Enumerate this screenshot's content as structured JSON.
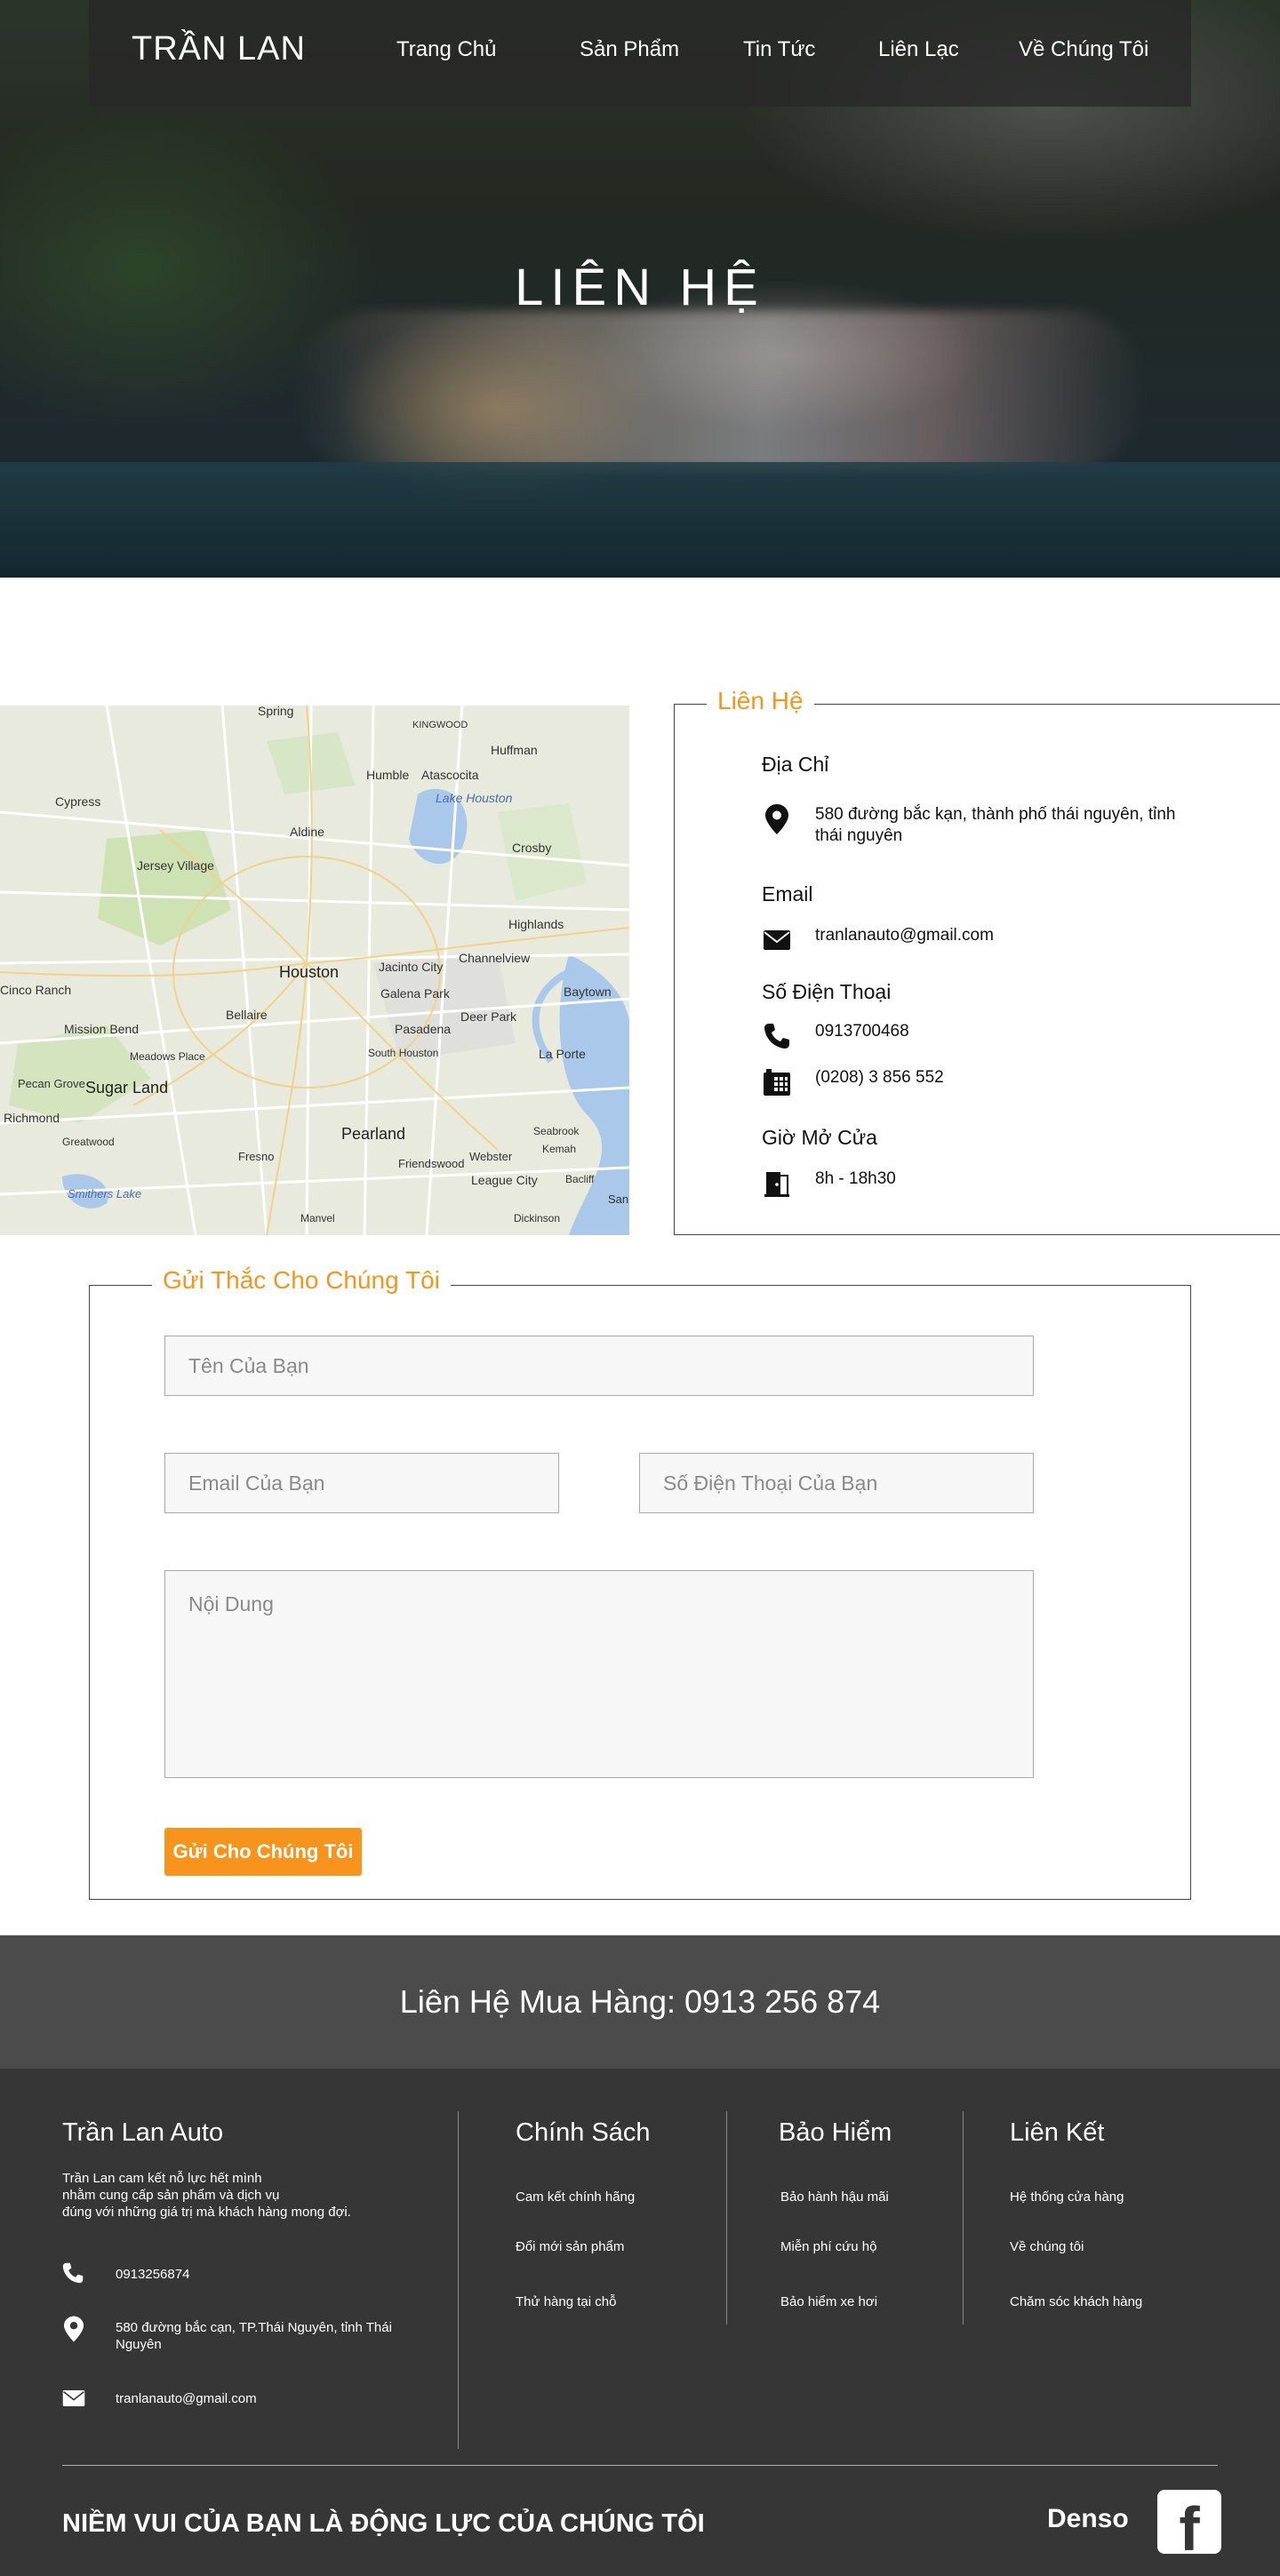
{
  "brand": "TRẦN LAN",
  "nav": [
    {
      "label": "Trang Chủ"
    },
    {
      "label": "Sản Phẩm"
    },
    {
      "label": "Tin Tức"
    },
    {
      "label": "Liên Lạc"
    },
    {
      "label": "Về Chúng Tôi"
    }
  ],
  "hero": {
    "title": "LIÊN HỆ"
  },
  "map": {
    "labels": [
      "Spring",
      "KINGWOOD",
      "Huffman",
      "Humble",
      "Atascocita",
      "Lake Houston",
      "Cypress",
      "Aldine",
      "Crosby",
      "Jersey Village",
      "Highlands",
      "Houston",
      "Channelview",
      "Cinco Ranch",
      "Jacinto City",
      "Galena Park",
      "Baytown",
      "Bellaire",
      "Deer Park",
      "Mission Bend",
      "Pasadena",
      "Meadows Place",
      "South Houston",
      "La Porte",
      "Pecan Grove",
      "Sugar Land",
      "Richmond",
      "Pearland",
      "Seabrook",
      "Kemah",
      "Greatwood",
      "Fresno",
      "Friendswood",
      "Webster",
      "League City",
      "Bacliff",
      "Smithers Lake",
      "Manvel",
      "Dickinson",
      "San"
    ]
  },
  "contact": {
    "legend": "Liên Hệ",
    "address_title": "Địa Chỉ",
    "address": "580 đường bắc kạn, thành phố thái nguyên, tỉnh thái nguyên",
    "email_title": "Email",
    "email": "tranlanauto@gmail.com",
    "phone_title": "Số Điện Thoại",
    "phone": "0913700468",
    "landline": "(0208) 3 856 552",
    "hours_title": "Giờ Mở Cửa",
    "hours": "8h - 18h30"
  },
  "form": {
    "legend": "Gửi Thắc Cho Chúng Tôi",
    "name_placeholder": "Tên Của Bạn",
    "email_placeholder": "Email Của Bạn",
    "phone_placeholder": "Số Điện Thoại Của Bạn",
    "content_placeholder": "Nội Dung",
    "submit_label": "Gửi Cho Chúng Tôi"
  },
  "band": {
    "text": "Liên Hệ Mua Hàng:  0913 256 874"
  },
  "footer": {
    "about_title": "Trần Lan Auto",
    "about_lines": [
      "Trần Lan cam kết nỗ lực hết mình",
      "nhằm cung cấp sản phẩm và dịch vụ",
      "đúng với những giá trị mà khách hàng mong đợi."
    ],
    "phone": "0913256874",
    "address": "580 đường bắc cạn, TP.Thái Nguyên, tỉnh Thái Nguyên",
    "email": "tranlanauto@gmail.com",
    "policy_title": "Chính Sách",
    "policy_links": [
      "Cam kết chính hãng",
      "Đổi mới sản phẩm",
      "Thử hàng tại chỗ"
    ],
    "warranty_title": "Bảo Hiểm",
    "warranty_links": [
      "Bảo hành hậu mãi",
      "Miễn phí cứu hộ",
      "Bảo hiểm xe hơi"
    ],
    "links_title": "Liên Kết",
    "links": [
      "Hệ thống cửa hàng",
      "Về chúng tôi",
      "Chăm sóc khách hàng"
    ],
    "motto": "NIỀM VUI CỦA BẠN LÀ ĐỘNG LỰC CỦA CHÚNG TÔI",
    "partner": "Denso",
    "social_glyph": "f"
  },
  "colors": {
    "accent": "#f7941d",
    "band": "#4b4b4b",
    "footer": "#363636"
  },
  "icons": [
    "map-pin-icon",
    "envelope-icon",
    "phone-icon",
    "fax-icon",
    "door-icon",
    "facebook-icon"
  ]
}
